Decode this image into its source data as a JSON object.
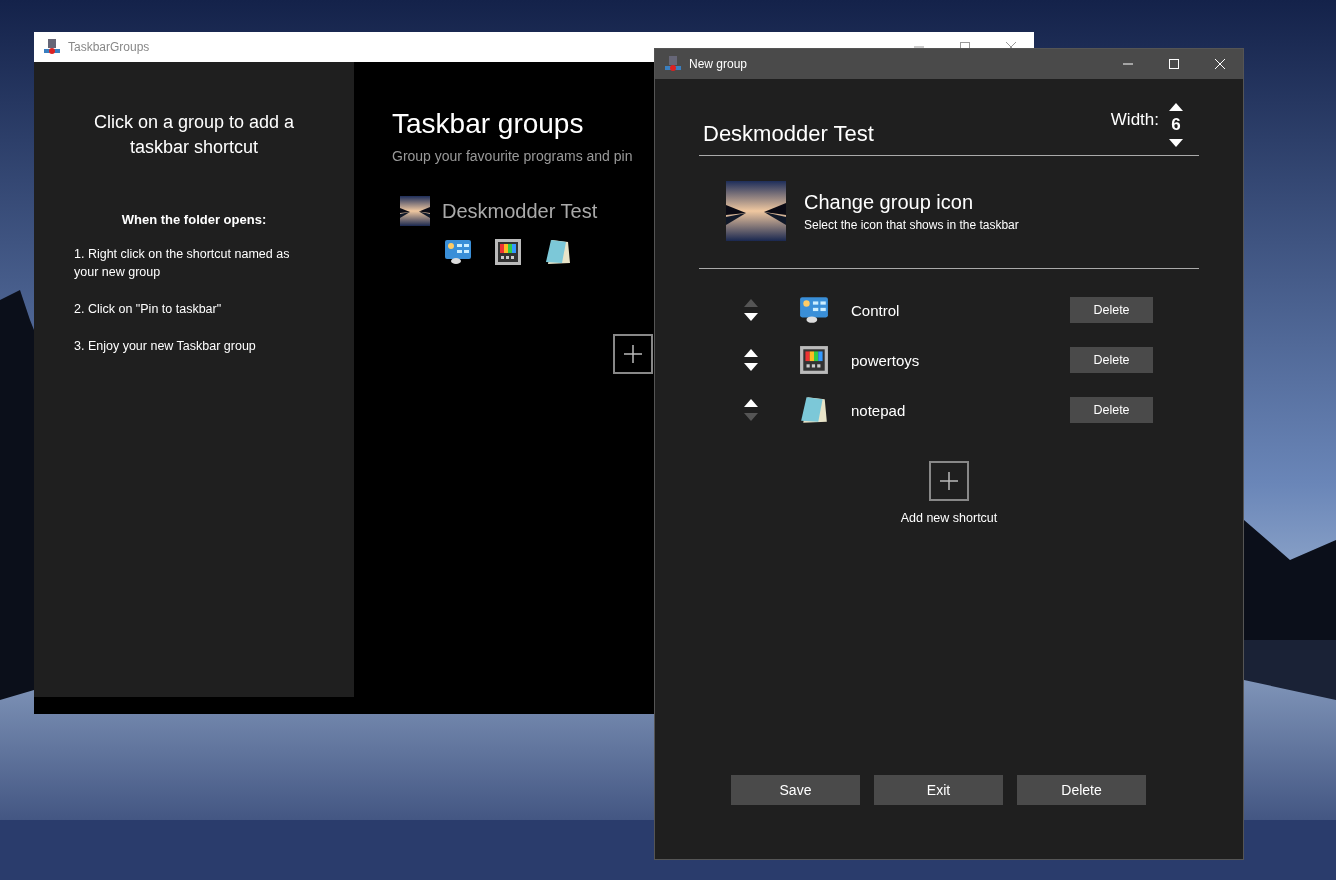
{
  "main_window": {
    "title": "TaskbarGroups",
    "sidebar": {
      "heading": "Click on a group to add a taskbar shortcut",
      "subheading": "When the folder opens:",
      "steps": [
        "1. Right click on the shortcut named as your new group",
        "2. Click on \"Pin to taskbar\"",
        "3. Enjoy your new Taskbar group"
      ]
    },
    "heading": "Taskbar groups",
    "subtitle": "Group your favourite programs and pin",
    "groups": [
      {
        "name": "Deskmodder Test"
      }
    ]
  },
  "dialog": {
    "title": "New group",
    "group_name": "Deskmodder Test",
    "width_label": "Width:",
    "width_value": "6",
    "change_icon_title": "Change group icon",
    "change_icon_hint": "Select the icon that shows in the taskbar",
    "shortcuts": [
      {
        "name": "Control",
        "up_enabled": false,
        "down_enabled": true,
        "delete_label": "Delete"
      },
      {
        "name": "powertoys",
        "up_enabled": true,
        "down_enabled": true,
        "delete_label": "Delete"
      },
      {
        "name": "notepad",
        "up_enabled": true,
        "down_enabled": false,
        "delete_label": "Delete"
      }
    ],
    "add_shortcut_label": "Add new shortcut",
    "buttons": [
      "Save",
      "Exit",
      "Delete"
    ]
  }
}
